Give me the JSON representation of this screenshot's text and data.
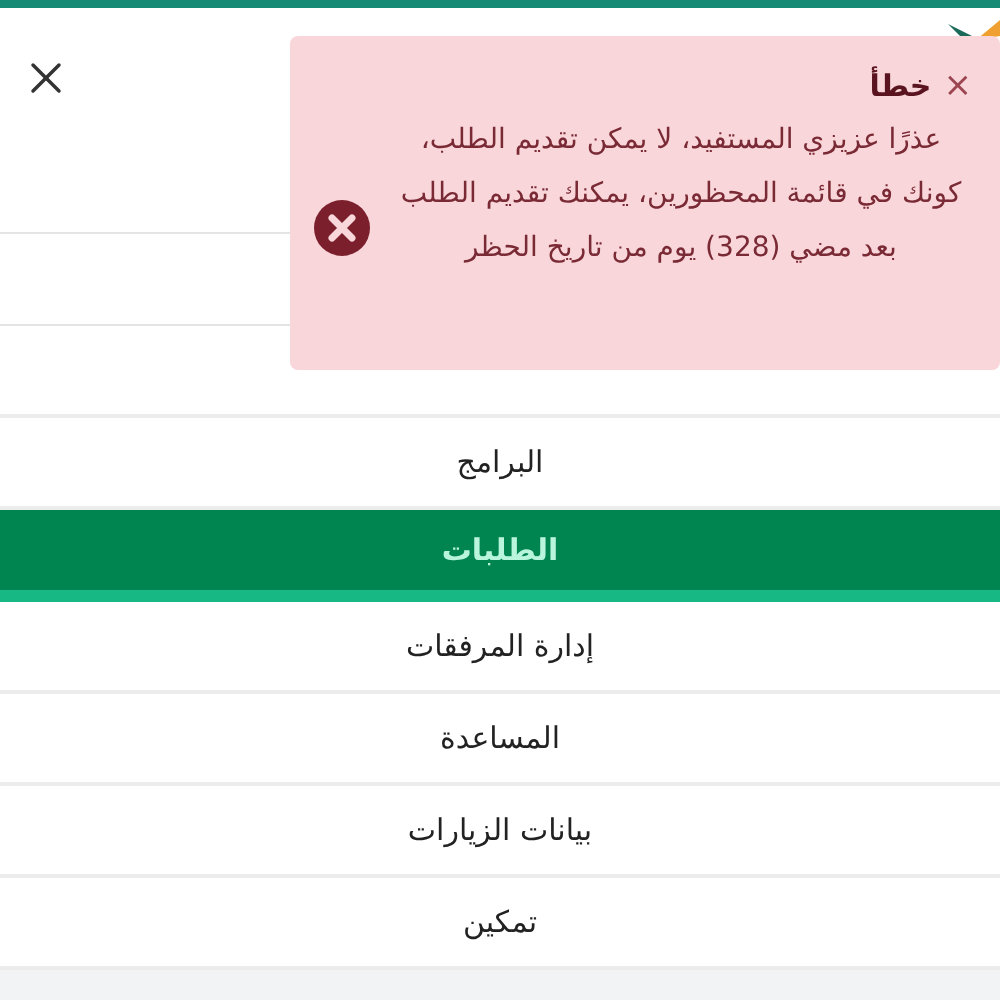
{
  "toast": {
    "close": "×",
    "title": "خطأ",
    "message": "عذرًا عزيزي المستفيد، لا يمكن تقديم الطلب، كونك في قائمة المحظورين، يمكنك تقديم الطلب بعد مضي (328) يوم من تاريخ الحظر"
  },
  "menu": [
    {
      "label": "البرامج",
      "selected": false
    },
    {
      "label": "الطلبات",
      "selected": true
    },
    {
      "label": "إدارة المرفقات",
      "selected": false
    },
    {
      "label": "المساعدة",
      "selected": false
    },
    {
      "label": "بيانات الزيارات",
      "selected": false
    },
    {
      "label": "تمكين",
      "selected": false
    }
  ]
}
